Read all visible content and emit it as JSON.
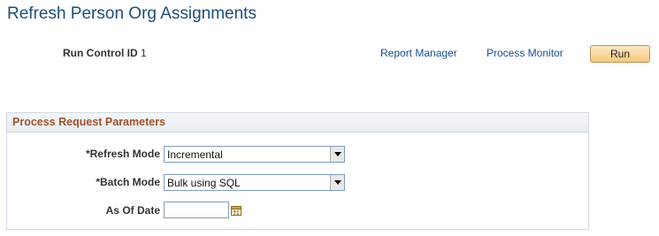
{
  "page": {
    "title": "Refresh Person Org Assignments"
  },
  "run_control": {
    "label": "Run Control ID",
    "value": "1"
  },
  "links": {
    "report_manager": "Report Manager",
    "process_monitor": "Process Monitor"
  },
  "buttons": {
    "run": "Run"
  },
  "params": {
    "header": "Process Request Parameters",
    "refresh_mode": {
      "label": "*Refresh Mode",
      "value": "Incremental"
    },
    "batch_mode": {
      "label": "*Batch Mode",
      "value": "Bulk using SQL"
    },
    "as_of_date": {
      "label": "As Of Date",
      "value": ""
    }
  },
  "colors": {
    "title": "#1f4e79",
    "link": "#1a4d8f",
    "group_title": "#a0522d",
    "run_button": "#f5c97d"
  },
  "icons": {
    "dropdown": "chevron-down-icon",
    "calendar": "calendar-icon"
  }
}
